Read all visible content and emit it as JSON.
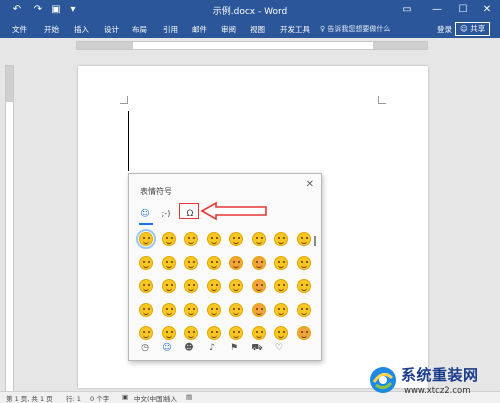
{
  "window": {
    "title": "示例.docx - Word",
    "quick_access": [
      "undo-icon",
      "redo-icon",
      "save-icon",
      "customize-icon"
    ],
    "controls": [
      "ribbon-display-icon",
      "minimize-icon",
      "maximize-icon",
      "close-icon"
    ]
  },
  "ribbon": {
    "tabs": [
      "文件",
      "开始",
      "插入",
      "设计",
      "布局",
      "引用",
      "邮件",
      "审阅",
      "视图",
      "开发工具"
    ],
    "search_placeholder": "告诉我您想要做什么",
    "login": "登录",
    "share": "共享"
  },
  "emoji_panel": {
    "title": "表情符号",
    "tabs": [
      {
        "name": "emoji",
        "glyph": "☺",
        "selected": true
      },
      {
        "name": "kaomoji",
        "glyph": ";-)"
      },
      {
        "name": "symbols",
        "glyph": "Ω"
      }
    ],
    "categories": [
      "recent-icon",
      "smiley-icon",
      "people-icon",
      "celebration-icon",
      "food-icon",
      "travel-icon",
      "heart-icon"
    ],
    "grid_rows": 5,
    "grid_cols": 8
  },
  "status_bar": {
    "page": "第 1 页, 共 1 页",
    "line": "行: 1",
    "words": "0 个字",
    "language": "中文(中国)",
    "mode": "插入"
  },
  "watermark": {
    "title": "系统重装网",
    "url": "www.xtcz2.com"
  },
  "colors": {
    "accent": "#2b579a",
    "highlight": "#e53935",
    "emoji_yellow": "#f9c623"
  }
}
